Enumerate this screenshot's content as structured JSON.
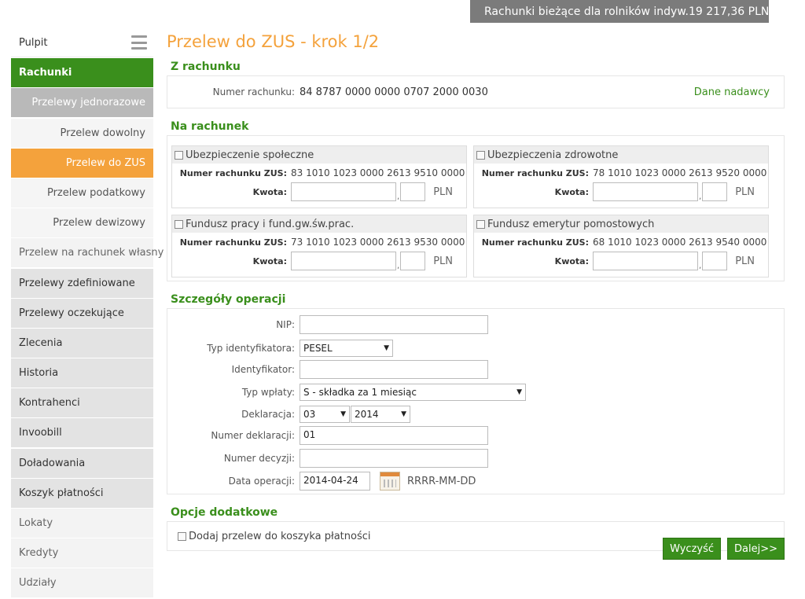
{
  "account_bar": {
    "name": "Rachunki bieżące dla rolników indyw.",
    "balance": "19 217,36 PLN"
  },
  "sidebar": {
    "items": [
      {
        "label": "Pulpit",
        "style": "white"
      },
      {
        "label": "Rachunki",
        "style": "green"
      },
      {
        "label": "Przelewy jednorazowe",
        "style": "gray"
      },
      {
        "label": "Przelew dowolny",
        "style": "sub"
      },
      {
        "label": "Przelew do ZUS",
        "style": "orange"
      },
      {
        "label": "Przelew podatkowy",
        "style": "sub"
      },
      {
        "label": "Przelew dewizowy",
        "style": "sub"
      },
      {
        "label": "Przelew na rachunek własny",
        "style": "pale"
      },
      {
        "label": "Przelewy zdefiniowane",
        "style": "normal"
      },
      {
        "label": "Przelewy oczekujące",
        "style": "normal"
      },
      {
        "label": "Zlecenia",
        "style": "normal"
      },
      {
        "label": "Historia",
        "style": "normal"
      },
      {
        "label": "Kontrahenci",
        "style": "normal"
      },
      {
        "label": "Invoobill",
        "style": "normal"
      },
      {
        "label": "Doładowania",
        "style": "normal"
      },
      {
        "label": "Koszyk płatności",
        "style": "normal"
      },
      {
        "label": "Lokaty",
        "style": "pale"
      },
      {
        "label": "Kredyty",
        "style": "pale"
      },
      {
        "label": "Udziały",
        "style": "pale"
      }
    ]
  },
  "page_title": "Przelew do ZUS - krok 1/2",
  "z_rachunku": {
    "title": "Z rachunku",
    "label": "Numer rachunku:",
    "value": "84 8787 0000 0000 0707 2000 0030",
    "link": "Dane nadawcy"
  },
  "na_rachunek": {
    "title": "Na rachunek",
    "number_label": "Numer rachunku ZUS:",
    "amount_label": "Kwota:",
    "currency": "PLN",
    "boxes": [
      {
        "title": "Ubezpieczenie społeczne",
        "account": "83 1010 1023 0000 2613 9510 0000"
      },
      {
        "title": "Ubezpieczenia zdrowotne",
        "account": "78 1010 1023 0000 2613 9520 0000"
      },
      {
        "title": "Fundusz pracy i fund.gw.św.prac.",
        "account": "73 1010 1023 0000 2613 9530 0000"
      },
      {
        "title": "Fundusz emerytur pomostowych",
        "account": "68 1010 1023 0000 2613 9540 0000"
      }
    ]
  },
  "szczegoly": {
    "title": "Szczegóły operacji",
    "nip_label": "NIP:",
    "nip_value": "",
    "id_type_label": "Typ identyfikatora:",
    "id_type_value": "PESEL",
    "id_label": "Identyfikator:",
    "id_value": "",
    "payment_type_label": "Typ wpłaty:",
    "payment_type_value": "S - składka za 1 miesiąc",
    "declaration_label": "Deklaracja:",
    "declaration_month": "03",
    "declaration_year": "2014",
    "declaration_no_label": "Numer deklaracji:",
    "declaration_no_value": "01",
    "decision_no_label": "Numer decyzji:",
    "decision_no_value": "",
    "date_label": "Data operacji:",
    "date_value": "2014-04-24",
    "date_format": "RRRR-MM-DD"
  },
  "opcje": {
    "title": "Opcje dodatkowe",
    "basket_label": "Dodaj przelew do koszyka płatności"
  },
  "buttons": {
    "clear": "Wyczyść",
    "next": "Dalej>>"
  }
}
